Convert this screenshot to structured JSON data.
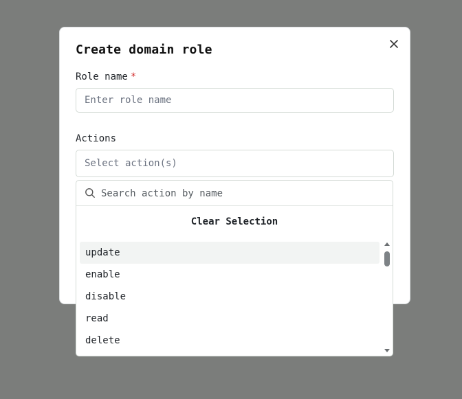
{
  "modal": {
    "title": "Create domain role",
    "role_name_label": "Role name",
    "required_mark": "*",
    "role_name_placeholder": "Enter role name",
    "role_name_value": "",
    "actions_label": "Actions",
    "actions_placeholder": "Select action(s)"
  },
  "dropdown": {
    "search_placeholder": "Search action by name",
    "clear_label": "Clear Selection",
    "options": [
      "update",
      "enable",
      "disable",
      "read",
      "delete"
    ]
  },
  "icons": {
    "close": "close-icon",
    "search": "search-icon"
  },
  "colors": {
    "overlay": "#7b7d7b",
    "required": "#d32f2f",
    "active_option_bg": "#f2f4f3"
  }
}
